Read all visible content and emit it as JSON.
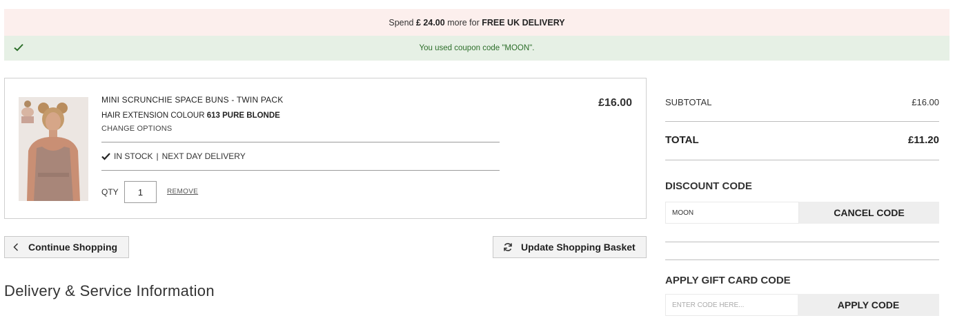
{
  "banners": {
    "delivery_prefix": "Spend",
    "delivery_amount": "£ 24.00",
    "delivery_middle": "more for",
    "delivery_offer": "FREE UK DELIVERY",
    "coupon_message": "You used coupon code \"MOON\"."
  },
  "basket_item": {
    "name": "MINI SCRUNCHIE SPACE BUNS - TWIN PACK",
    "colour_label": "HAIR EXTENSION COLOUR",
    "colour_value": "613 PURE BLONDE",
    "change_options": "CHANGE OPTIONS",
    "stock": "IN STOCK",
    "separator": "|",
    "delivery": "NEXT DAY DELIVERY",
    "qty_label": "QTY",
    "qty_value": "1",
    "remove_label": "REMOVE",
    "price": "£16.00"
  },
  "actions": {
    "continue_label": "Continue Shopping",
    "update_label": "Update Shopping Basket"
  },
  "delivery_heading": "Delivery & Service Information",
  "summary": {
    "subtotal_label": "SUBTOTAL",
    "subtotal_value": "£16.00",
    "total_label": "TOTAL",
    "total_value": "£11.20",
    "discount_title": "DISCOUNT CODE",
    "discount_value": "MOON",
    "cancel_code_label": "CANCEL CODE",
    "giftcard_title": "APPLY GIFT CARD CODE",
    "giftcard_placeholder": "ENTER CODE HERE...",
    "apply_code_label": "APPLY CODE"
  },
  "colors": {
    "delivery_banner_bg": "#fcefed",
    "coupon_banner_bg": "#e6f0e5",
    "coupon_text": "#2c6e2a",
    "check_icon": "#2c6e2a"
  },
  "icons": {
    "coupon_check": "check-icon",
    "stock_check": "check-icon",
    "continue": "chevron-left-icon",
    "update": "refresh-icon"
  }
}
